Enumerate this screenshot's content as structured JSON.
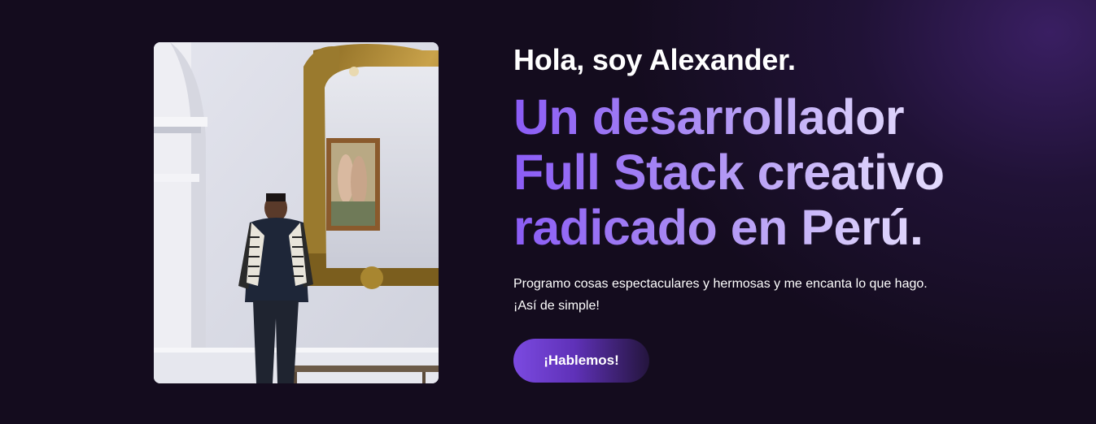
{
  "hero": {
    "greeting": "Hola, soy Alexander.",
    "headline_lines": [
      "Un desarrollador",
      "Full Stack creativo",
      "radicado en Perú."
    ],
    "description": "Programo cosas espectaculares y hermosas y me encanta lo que hago. ¡Así de simple!",
    "cta_label": "¡Hablemos!",
    "photo_alt": "Alexander de pie junto a un espejo dorado"
  },
  "colors": {
    "background": "#140c1e",
    "accent": "#8b5cf6",
    "accent_light": "#d8ccfb",
    "text": "#ffffff"
  }
}
